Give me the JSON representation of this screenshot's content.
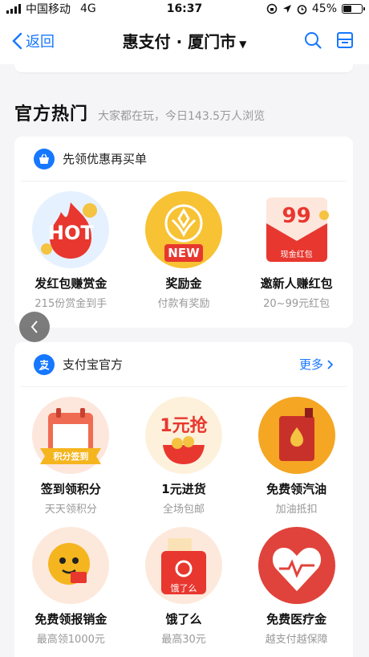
{
  "status": {
    "carrier": "中国移动",
    "network": "4G",
    "time": "16:37",
    "battery": "45%",
    "battery_level": 0.45
  },
  "nav": {
    "back_label": "返回",
    "title": "惠支付 · 厦门市"
  },
  "section": {
    "title": "官方热门",
    "subtitle": "大家都在玩，今日143.5万人浏览"
  },
  "card1": {
    "title": "先领优惠再买单",
    "items": [
      {
        "name": "发红包赚赏金",
        "desc": "215份赏金到手",
        "badge": "HOT"
      },
      {
        "name": "奖励金",
        "desc": "付款有奖励",
        "badge": "NEW"
      },
      {
        "name": "邀新人赚红包",
        "desc": "20~99元红包",
        "amount": "99",
        "envelope_label": "现金红包"
      }
    ]
  },
  "card2": {
    "title": "支付宝官方",
    "more": "更多",
    "items": [
      {
        "name": "签到领积分",
        "desc": "天天领积分",
        "ribbon": "积分签到"
      },
      {
        "name": "1元进货",
        "desc": "全场包邮",
        "art_text": "1元抢"
      },
      {
        "name": "免费领汽油",
        "desc": "加油抵扣"
      },
      {
        "name": "免费领报销金",
        "desc": "最高领1000元"
      },
      {
        "name": "饿了么",
        "desc": "最高30元",
        "brand": "饿了么"
      },
      {
        "name": "免费医疗金",
        "desc": "越支付越保障"
      }
    ]
  },
  "colors": {
    "accent": "#1677ff",
    "red": "#e8372f",
    "gold": "#f5b51f"
  }
}
